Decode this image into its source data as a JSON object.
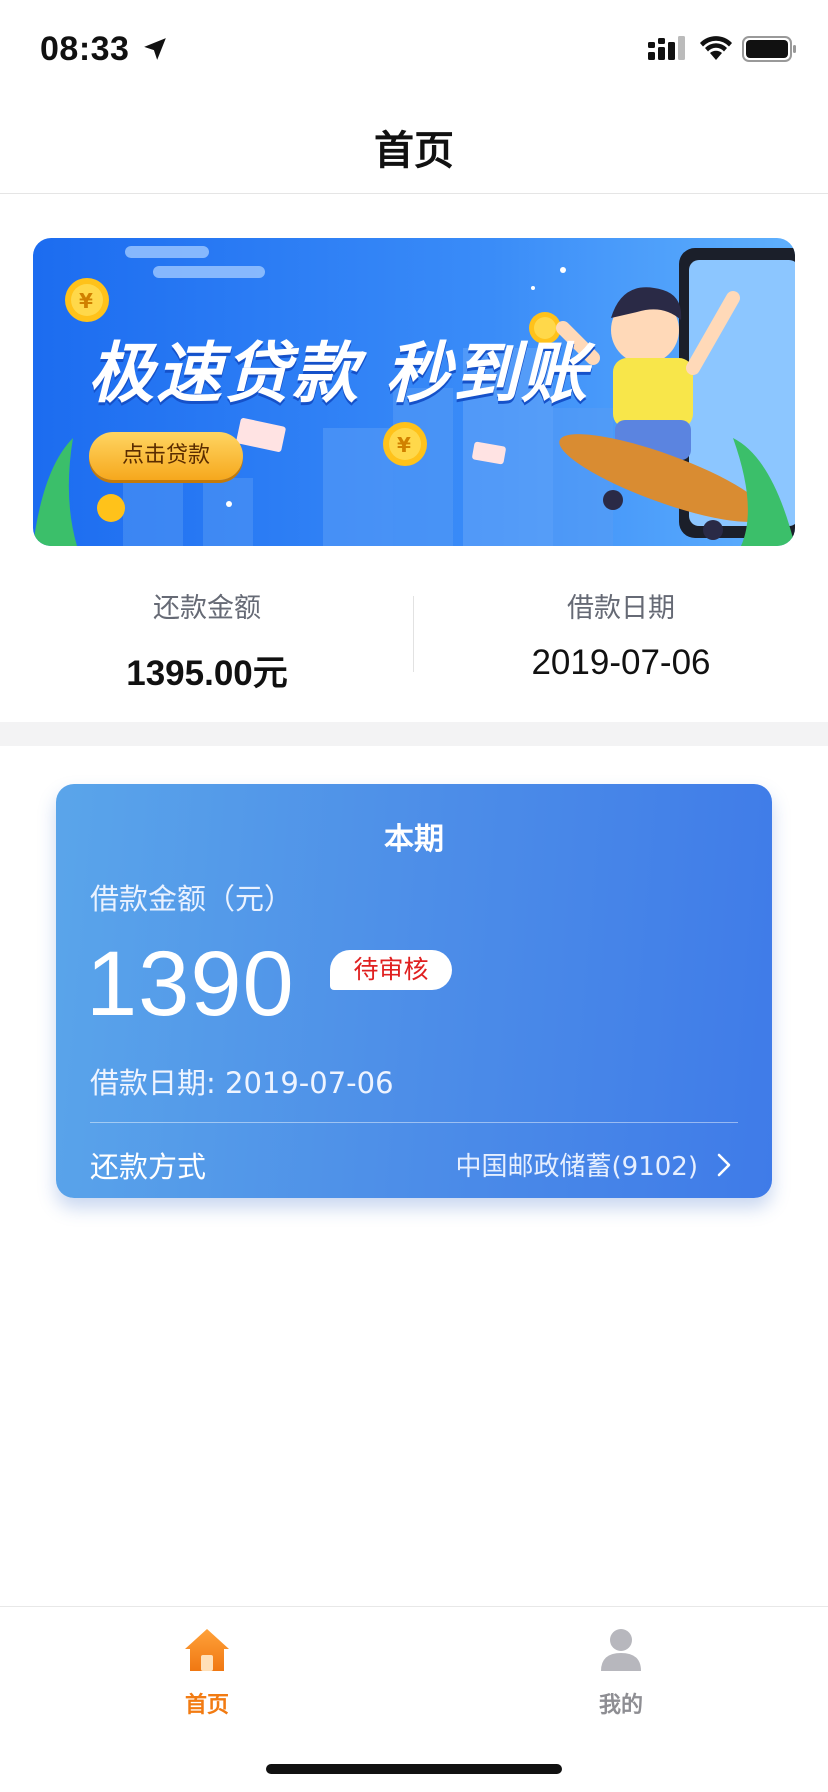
{
  "status_bar": {
    "time": "08:33"
  },
  "header": {
    "title": "首页"
  },
  "banner": {
    "headline": "极速贷款 秒到账",
    "button_label": "点击贷款"
  },
  "summary": {
    "repay_amount_label": "还款金额",
    "repay_amount_value": "1395.00元",
    "loan_date_label": "借款日期",
    "loan_date_value": "2019-07-06"
  },
  "loan_card": {
    "title": "本期",
    "amount_label": "借款金额（元）",
    "amount_value": "1390",
    "status_badge": "待审核",
    "loan_date": "借款日期: 2019-07-06",
    "repay_method_label": "还款方式",
    "repay_method_value": "中国邮政储蓄(9102)"
  },
  "tab_bar": {
    "items": [
      {
        "label": "首页",
        "icon": "home-icon",
        "active": true
      },
      {
        "label": "我的",
        "icon": "user-icon",
        "active": false
      }
    ]
  },
  "colors": {
    "accent": "#f27b12",
    "card_blue": "#4d8ee8",
    "badge_red": "#e02020"
  }
}
